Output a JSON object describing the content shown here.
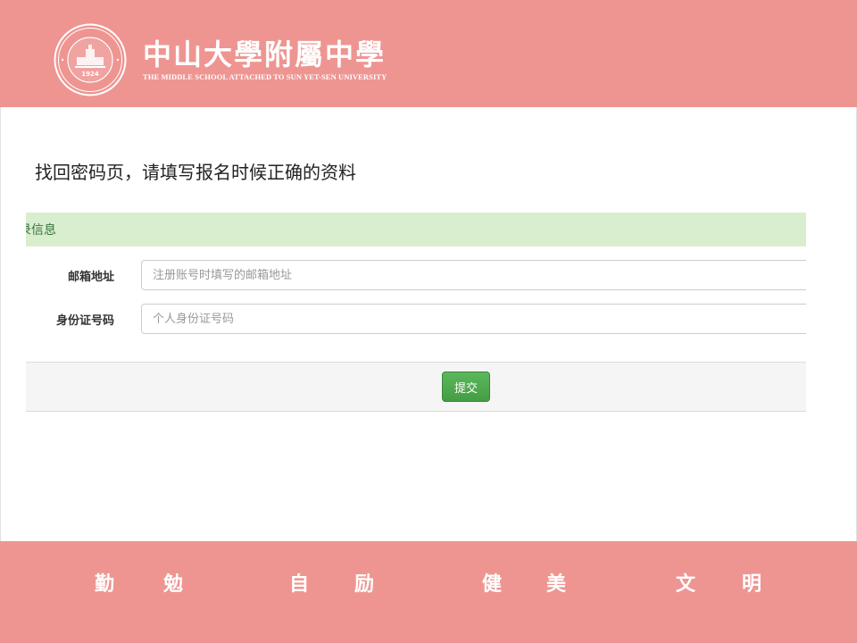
{
  "header": {
    "logo_cn": "中山大學附屬中學",
    "logo_en": "THE MIDDLE SCHOOL ATTACHED TO  SUN YET-SEN UNIVERSITY",
    "seal_year": "1924",
    "brand_color": "#ee9592"
  },
  "main": {
    "page_title": "找回密码页，请填写报名时候正确的资料",
    "panel_heading": "录信息",
    "fields": [
      {
        "label": "邮箱地址",
        "placeholder": "注册账号时填写的邮箱地址",
        "value": ""
      },
      {
        "label": "身份证号码",
        "placeholder": "个人身份证号码",
        "value": ""
      }
    ],
    "submit_label": "提交",
    "submit_color": "#5cb85c",
    "heading_color": "#d9edcf"
  },
  "footer": {
    "motto": [
      "勤",
      "勉",
      "自",
      "励",
      "健",
      "美",
      "文",
      "明"
    ]
  }
}
